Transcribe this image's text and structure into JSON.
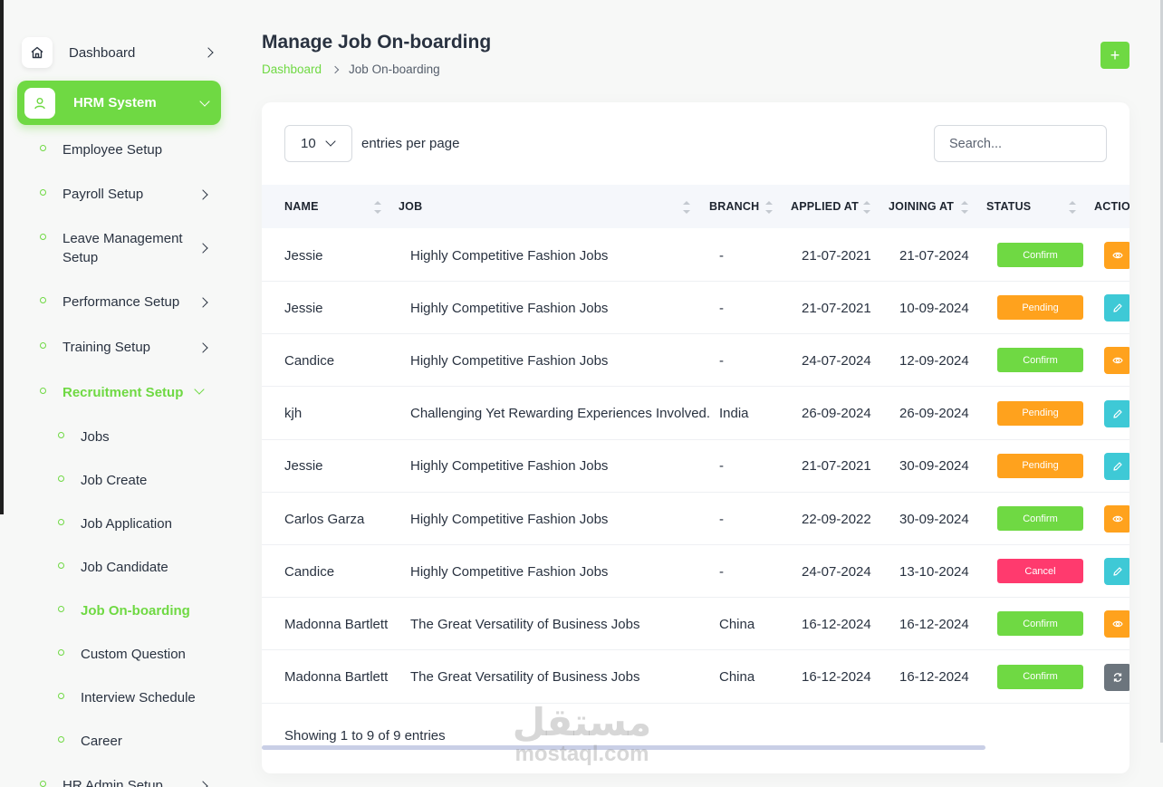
{
  "sidebar": {
    "dashboard_label": "Dashboard",
    "hrm_label": "HRM System",
    "items": [
      {
        "label": "Employee Setup"
      },
      {
        "label": "Payroll Setup"
      },
      {
        "label": "Leave Management Setup"
      },
      {
        "label": "Performance Setup"
      },
      {
        "label": "Training Setup"
      },
      {
        "label": "Recruitment Setup"
      },
      {
        "label": "HR Admin Setup"
      }
    ],
    "recruitment_children": [
      {
        "label": "Jobs"
      },
      {
        "label": "Job Create"
      },
      {
        "label": "Job Application"
      },
      {
        "label": "Job Candidate"
      },
      {
        "label": "Job On-boarding"
      },
      {
        "label": "Custom Question"
      },
      {
        "label": "Interview Schedule"
      },
      {
        "label": "Career"
      }
    ]
  },
  "header": {
    "title": "Manage Job On-boarding",
    "breadcrumb": [
      "Dashboard",
      "Job On-boarding"
    ],
    "add_label": "+"
  },
  "table": {
    "entries_value": "10",
    "entries_label": "entries per page",
    "search_placeholder": "Search...",
    "columns": [
      "NAME",
      "JOB",
      "BRANCH",
      "APPLIED AT",
      "JOINING AT",
      "STATUS",
      "ACTION"
    ],
    "rows": [
      {
        "name": "Jessie",
        "job": "Highly Competitive Fashion Jobs",
        "branch": "-",
        "applied": "21-07-2021",
        "joining": "21-07-2024",
        "status": "Confirm",
        "action_icon": "eye-icon"
      },
      {
        "name": "Jessie",
        "job": "Highly Competitive Fashion Jobs",
        "branch": "-",
        "applied": "21-07-2021",
        "joining": "10-09-2024",
        "status": "Pending",
        "action_icon": "pencil-icon"
      },
      {
        "name": "Candice",
        "job": "Highly Competitive Fashion Jobs",
        "branch": "-",
        "applied": "24-07-2024",
        "joining": "12-09-2024",
        "status": "Confirm",
        "action_icon": "eye-icon"
      },
      {
        "name": "kjh",
        "job": "Challenging Yet Rewarding Experiences Involved.",
        "branch": "India",
        "applied": "26-09-2024",
        "joining": "26-09-2024",
        "status": "Pending",
        "action_icon": "pencil-icon"
      },
      {
        "name": "Jessie",
        "job": "Highly Competitive Fashion Jobs",
        "branch": "-",
        "applied": "21-07-2021",
        "joining": "30-09-2024",
        "status": "Pending",
        "action_icon": "pencil-icon"
      },
      {
        "name": "Carlos Garza",
        "job": "Highly Competitive Fashion Jobs",
        "branch": "-",
        "applied": "22-09-2022",
        "joining": "30-09-2024",
        "status": "Confirm",
        "action_icon": "eye-icon"
      },
      {
        "name": "Candice",
        "job": "Highly Competitive Fashion Jobs",
        "branch": "-",
        "applied": "24-07-2024",
        "joining": "13-10-2024",
        "status": "Cancel",
        "action_icon": "pencil-icon"
      },
      {
        "name": "Madonna Bartlett",
        "job": "The Great Versatility of Business Jobs",
        "branch": "China",
        "applied": "16-12-2024",
        "joining": "16-12-2024",
        "status": "Confirm",
        "action_icon": "eye-icon"
      },
      {
        "name": "Madonna Bartlett",
        "job": "The Great Versatility of Business Jobs",
        "branch": "China",
        "applied": "16-12-2024",
        "joining": "16-12-2024",
        "status": "Confirm",
        "action_icon": "convert-icon"
      }
    ],
    "footer": "Showing 1 to 9 of 9 entries"
  },
  "colors": {
    "primary": "#6fd943",
    "confirm": "#6fd943",
    "pending": "#ffa21d",
    "cancel": "#ff3a6e",
    "eye_action": "#ffa21d",
    "edit_action": "#3ec9d6",
    "convert_action": "#6c757d"
  },
  "watermark": {
    "arabic": "مستقل",
    "latin": "mostaql.com"
  }
}
